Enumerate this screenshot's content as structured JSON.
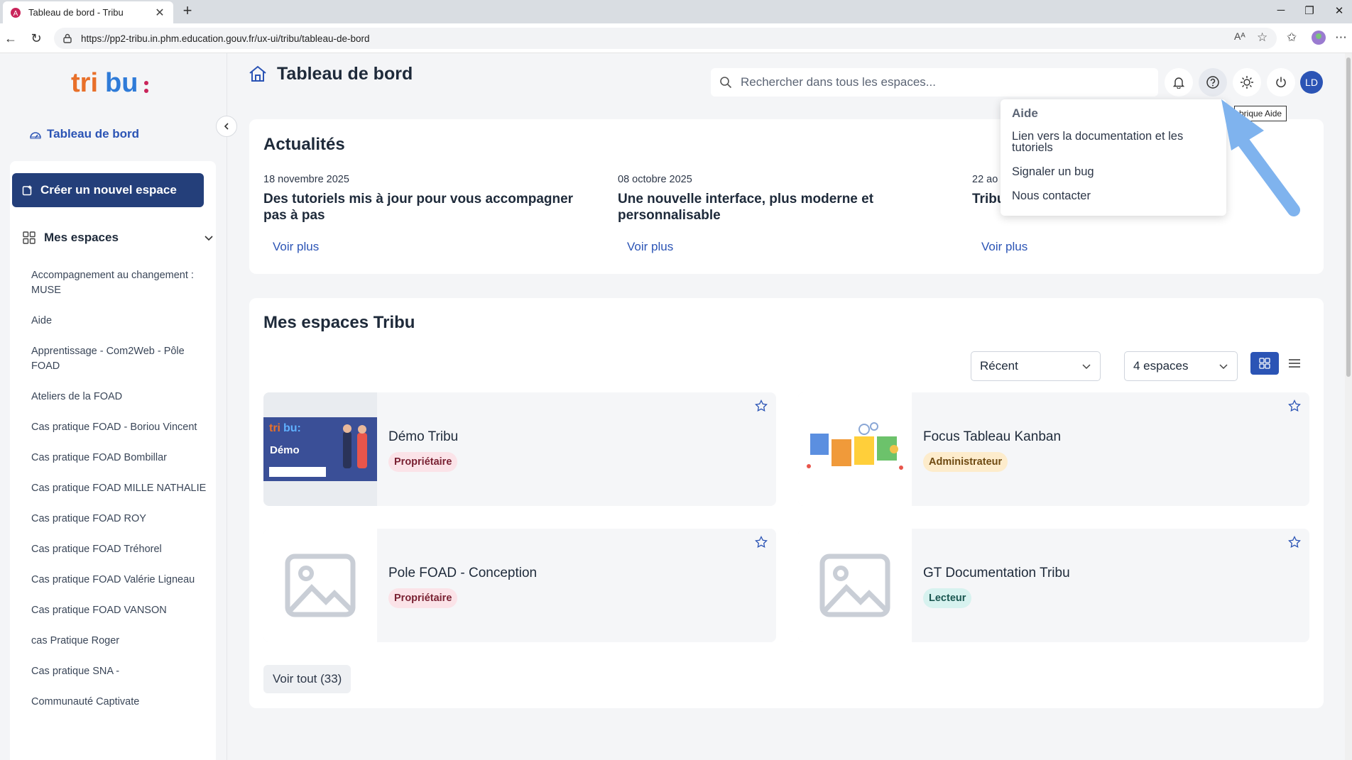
{
  "browser": {
    "tab_title": "Tableau de bord - Tribu",
    "url": "https://pp2-tribu.in.phm.education.gouv.fr/ux-ui/tribu/tableau-de-bord"
  },
  "sidebar": {
    "dashboard_label": "Tableau de bord",
    "create_label": "Créer un nouvel espace",
    "mes_espaces_label": "Mes espaces",
    "items": [
      "Accompagnement au changement : MUSE",
      "Aide",
      "Apprentissage - Com2Web - Pôle FOAD",
      "Ateliers de la FOAD",
      "Cas pratique FOAD - Boriou Vincent",
      "Cas pratique FOAD Bombillar",
      "Cas pratique FOAD MILLE NATHALIE",
      "Cas pratique FOAD ROY",
      "Cas pratique FOAD Tréhorel",
      "Cas pratique FOAD Valérie Ligneau",
      "Cas pratique FOAD VANSON",
      "cas Pratique Roger",
      "Cas pratique SNA -",
      "Communauté Captivate"
    ]
  },
  "header": {
    "title": "Tableau de bord",
    "search_placeholder": "Rechercher dans tous les espaces...",
    "avatar_initials": "LD",
    "tooltip": "brique Aide"
  },
  "help_menu": {
    "title": "Aide",
    "items": [
      "Lien vers la documentation et les tutoriels",
      "Signaler un bug",
      "Nous contacter"
    ]
  },
  "news": {
    "title": "Actualités",
    "more_label": "Voir plus",
    "items": [
      {
        "date": "18 novembre 2025",
        "title": "Des tutoriels mis à jour pour vous accompagner pas à pas"
      },
      {
        "date": "08 octobre 2025",
        "title": "Une nouvelle interface, plus moderne et personnalisable"
      },
      {
        "date": "22 ao",
        "title": "Tribu et une recherche optimisée"
      }
    ]
  },
  "spaces": {
    "title": "Mes espaces Tribu",
    "sort_value": "Récent",
    "count_value": "4 espaces",
    "see_all": "Voir tout (33)",
    "cards": [
      {
        "name": "Démo Tribu",
        "role": "Propriétaire",
        "thumb_label": "Démo"
      },
      {
        "name": "Focus Tableau Kanban",
        "role": "Administrateur"
      },
      {
        "name": "Pole FOAD - Conception",
        "role": "Propriétaire"
      },
      {
        "name": "GT Documentation Tribu",
        "role": "Lecteur"
      }
    ]
  },
  "colors": {
    "primary": "#2b54b5",
    "create_button": "#243f7a",
    "arrow": "#7fb3ee"
  }
}
